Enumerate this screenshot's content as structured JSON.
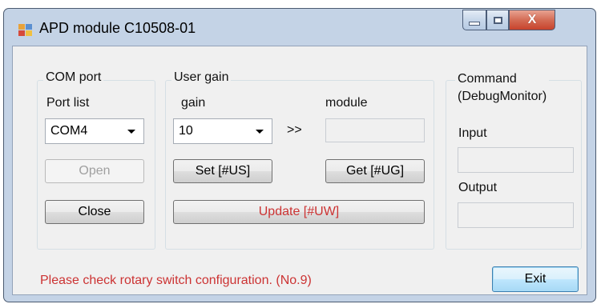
{
  "window": {
    "title": "APD module C10508-01",
    "controls": {
      "minimize_icon": "minimize-icon",
      "maximize_icon": "maximize-icon",
      "close_glyph": "X"
    }
  },
  "com_port": {
    "group_label": "COM port",
    "port_list_label": "Port list",
    "selected_port": "COM4",
    "open_button": "Open",
    "close_button": "Close"
  },
  "user_gain": {
    "group_label": "User gain",
    "gain_label": "gain",
    "module_label": "module",
    "selected_gain": "10",
    "arrow_text": ">>",
    "module_value": "",
    "set_button": "Set [#US]",
    "get_button": "Get [#UG]",
    "update_button": "Update [#UW]"
  },
  "command": {
    "group_label_line1": "Command",
    "group_label_line2": "(DebugMonitor)",
    "input_label": "Input",
    "input_value": "",
    "output_label": "Output",
    "output_value": ""
  },
  "status_message": "Please check rotary switch configuration. (No.9)",
  "exit_button": "Exit",
  "colors": {
    "status_text": "#cc3333",
    "update_text": "#cc3333",
    "frame": "#c4d3e6",
    "close_button": "#c8432c"
  }
}
